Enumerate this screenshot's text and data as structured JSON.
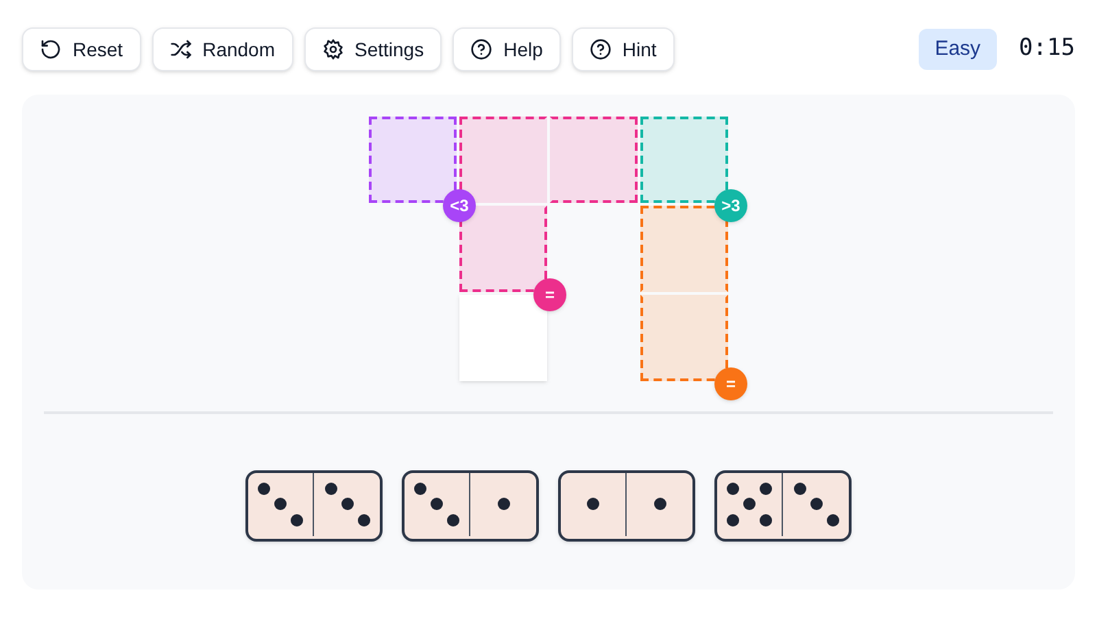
{
  "toolbar": [
    {
      "label": "Reset",
      "kind": "reset"
    },
    {
      "label": "Random",
      "kind": "random"
    },
    {
      "label": "Settings",
      "kind": "settings"
    },
    {
      "label": "Help",
      "kind": "help"
    },
    {
      "label": "Hint",
      "kind": "help"
    }
  ],
  "difficulty": "Easy",
  "timer": "0:15",
  "board": {
    "rows": [
      [
        {
          "kind": "region",
          "color": "#a845f7",
          "badge": "<3"
        },
        {
          "kind": "region",
          "color": "#ec2f8c"
        },
        {
          "kind": "region",
          "color": "#ec2f8c"
        },
        {
          "kind": "region",
          "color": "#14b8a6",
          "badge": ">3"
        }
      ],
      [
        {
          "kind": "none"
        },
        {
          "kind": "region",
          "color": "#ec2f8c",
          "badge": "="
        },
        {
          "kind": "none"
        },
        {
          "kind": "region",
          "color": "#f97316"
        }
      ],
      [
        {
          "kind": "none"
        },
        {
          "kind": "empty"
        },
        {
          "kind": "none"
        },
        {
          "kind": "region",
          "color": "#f97316",
          "badge": "="
        }
      ]
    ]
  },
  "dominoes": [
    {
      "halves": [
        {
          "kind": "three"
        },
        {
          "kind": "three"
        }
      ]
    },
    {
      "halves": [
        {
          "kind": "three"
        },
        {
          "kind": "one"
        }
      ]
    },
    {
      "halves": [
        {
          "kind": "one"
        },
        {
          "kind": "one"
        }
      ]
    },
    {
      "halves": [
        {
          "kind": "five"
        },
        {
          "kind": "three"
        }
      ]
    }
  ]
}
